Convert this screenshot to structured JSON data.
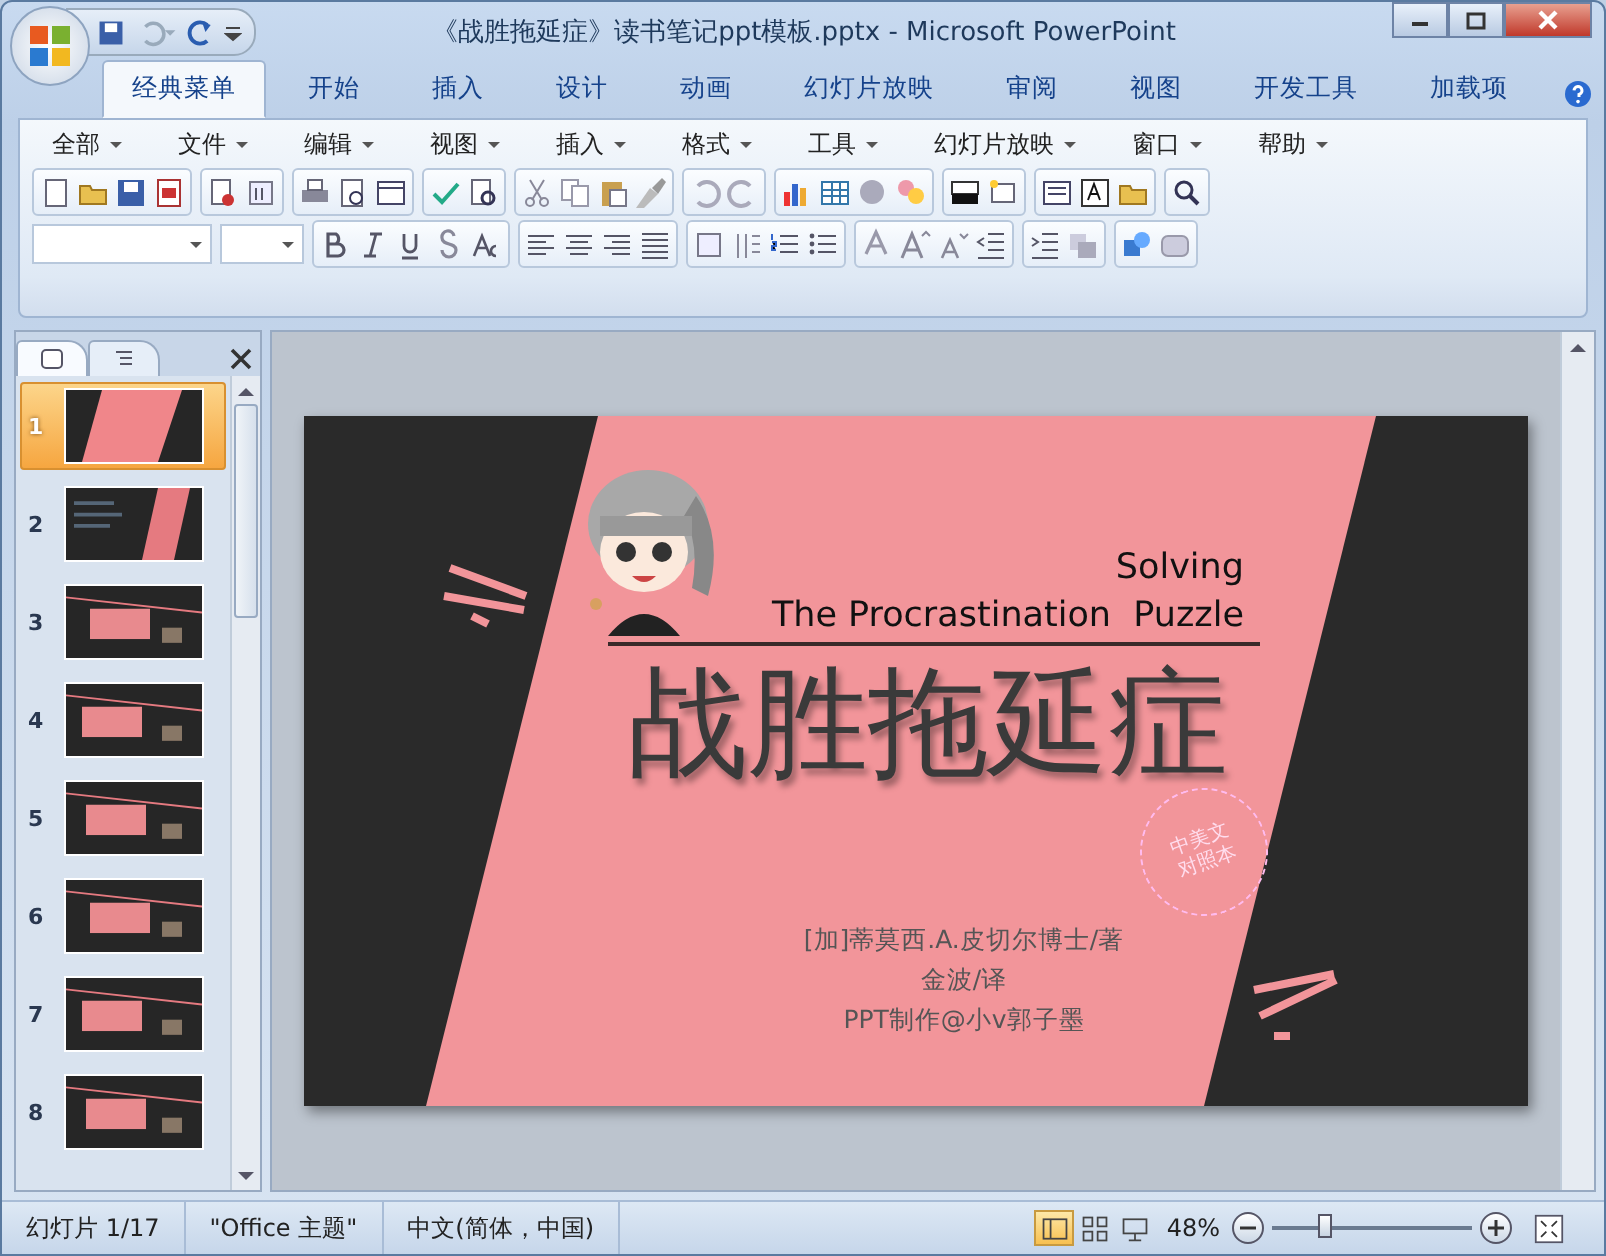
{
  "window": {
    "title": "《战胜拖延症》读书笔记ppt模板.pptx - Microsoft PowerPoint"
  },
  "ribbon_tabs": [
    {
      "label": "经典菜单",
      "selected": true
    },
    {
      "label": "开始",
      "selected": false
    },
    {
      "label": "插入",
      "selected": false
    },
    {
      "label": "设计",
      "selected": false
    },
    {
      "label": "动画",
      "selected": false
    },
    {
      "label": "幻灯片放映",
      "selected": false
    },
    {
      "label": "审阅",
      "selected": false
    },
    {
      "label": "视图",
      "selected": false
    },
    {
      "label": "开发工具",
      "selected": false
    },
    {
      "label": "加载项",
      "selected": false
    }
  ],
  "classic_menu": [
    "全部",
    "文件",
    "编辑",
    "视图",
    "插入",
    "格式",
    "工具",
    "幻灯片放映",
    "窗口",
    "帮助"
  ],
  "slide_panel": {
    "thumbnails": [
      {
        "number": "1",
        "selected": true
      },
      {
        "number": "2",
        "selected": false
      },
      {
        "number": "3",
        "selected": false
      },
      {
        "number": "4",
        "selected": false
      },
      {
        "number": "5",
        "selected": false
      },
      {
        "number": "6",
        "selected": false
      },
      {
        "number": "7",
        "selected": false
      },
      {
        "number": "8",
        "selected": false
      }
    ]
  },
  "slide": {
    "subtitle_line_1": "Solving",
    "subtitle_line_2": "The Procrastination  Puzzle",
    "title": "战胜拖延症",
    "stamp": [
      "中美文",
      "对照本"
    ],
    "credits": [
      "[加]蒂莫西.A.皮切尔博士/著",
      "金波/译",
      "PPT制作@小v郭子墨"
    ]
  },
  "status_bar": {
    "slide": "幻灯片 1/17",
    "theme": "\"Office 主题\"",
    "language": "中文(简体，中国)",
    "views": [
      {
        "selected": true
      },
      {
        "selected": false
      },
      {
        "selected": false
      }
    ],
    "zoom": "48%",
    "zoom_slider": {
      "level": 0.27
    }
  }
}
